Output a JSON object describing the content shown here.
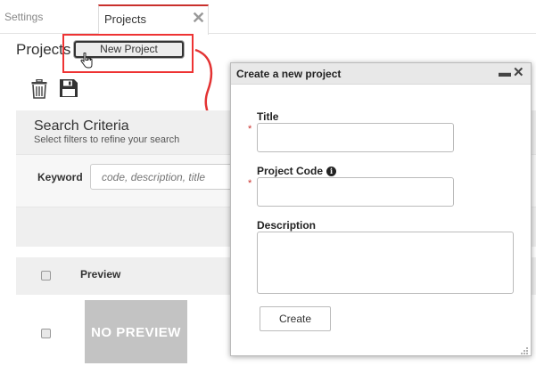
{
  "tabs": [
    {
      "label": "Settings",
      "active": false
    },
    {
      "label": "Projects",
      "active": true
    }
  ],
  "page": {
    "title": "Projects",
    "new_project_label": "New Project"
  },
  "toolbar": {
    "icons": [
      "trash-icon",
      "save-icon"
    ]
  },
  "search": {
    "title": "Search Criteria",
    "subtitle": "Select filters to refine your search",
    "keyword_label": "Keyword",
    "keyword_placeholder": "code, description, title"
  },
  "table": {
    "columns": [
      "Preview"
    ],
    "rows": [
      {
        "preview_text": "NO PREVIEW"
      }
    ]
  },
  "dialog": {
    "title": "Create a new project",
    "fields": [
      {
        "label": "Title",
        "required": "*",
        "value": ""
      },
      {
        "label": "Project Code",
        "required": "*",
        "value": ""
      },
      {
        "label": "Description",
        "value": ""
      }
    ],
    "create_label": "Create"
  },
  "colors": {
    "accent_red": "#e33333",
    "active_tab_border": "#c9302c",
    "panel_bg": "#efefef",
    "no_preview_bg": "#c3c3c3"
  }
}
